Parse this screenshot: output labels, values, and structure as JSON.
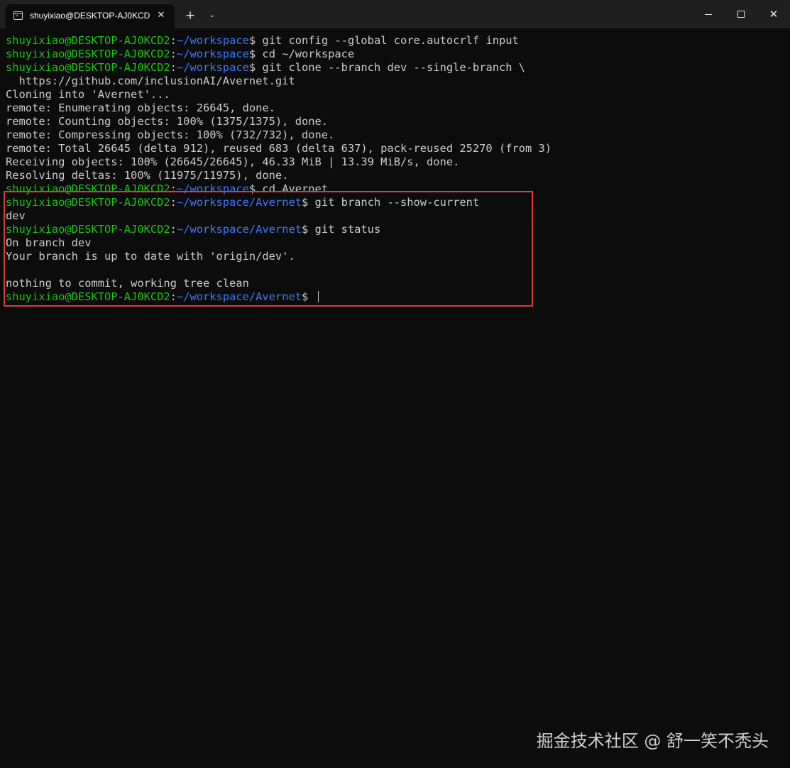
{
  "window": {
    "tab_title": "shuyixiao@DESKTOP-AJ0KCD2",
    "tab_icon": "terminal-icon",
    "tab_close_glyph": "✕",
    "new_tab_glyph": "+",
    "dropdown_glyph": "⌄",
    "close_glyph": "✕"
  },
  "terminal": {
    "prompt_user": "shuyixiao@DESKTOP-AJ0KCD2",
    "lines": [
      {
        "type": "prompt",
        "path": "~/workspace",
        "command": " git config --global core.autocrlf input"
      },
      {
        "type": "prompt",
        "path": "~/workspace",
        "command": " cd ~/workspace"
      },
      {
        "type": "prompt",
        "path": "~/workspace",
        "command": " git clone --branch dev --single-branch \\"
      },
      {
        "type": "output",
        "text": "  https://github.com/inclusionAI/Avernet.git"
      },
      {
        "type": "output",
        "text": "Cloning into 'Avernet'..."
      },
      {
        "type": "output",
        "text": "remote: Enumerating objects: 26645, done."
      },
      {
        "type": "output",
        "text": "remote: Counting objects: 100% (1375/1375), done."
      },
      {
        "type": "output",
        "text": "remote: Compressing objects: 100% (732/732), done."
      },
      {
        "type": "output",
        "text": "remote: Total 26645 (delta 912), reused 683 (delta 637), pack-reused 25270 (from 3)"
      },
      {
        "type": "output",
        "text": "Receiving objects: 100% (26645/26645), 46.33 MiB | 13.39 MiB/s, done."
      },
      {
        "type": "output",
        "text": "Resolving deltas: 100% (11975/11975), done."
      },
      {
        "type": "prompt",
        "path": "~/workspace",
        "command": " cd Avernet"
      },
      {
        "type": "prompt",
        "path": "~/workspace/Avernet",
        "command": " git branch --show-current"
      },
      {
        "type": "output",
        "text": "dev"
      },
      {
        "type": "prompt",
        "path": "~/workspace/Avernet",
        "command": " git status"
      },
      {
        "type": "output",
        "text": "On branch dev"
      },
      {
        "type": "output",
        "text": "Your branch is up to date with 'origin/dev'."
      },
      {
        "type": "output",
        "text": ""
      },
      {
        "type": "output",
        "text": "nothing to commit, working tree clean"
      },
      {
        "type": "prompt",
        "path": "~/workspace/Avernet",
        "command": " ",
        "cursor": true
      }
    ]
  },
  "watermark": "掘金技术社区 @ 舒一笑不秃头",
  "colors": {
    "background": "#0c0c0c",
    "tabbar": "#1f1f1f",
    "prompt_user": "#16c60c",
    "prompt_path": "#3b78ff",
    "text": "#cccccc",
    "highlight_border": "#e03a3a"
  }
}
